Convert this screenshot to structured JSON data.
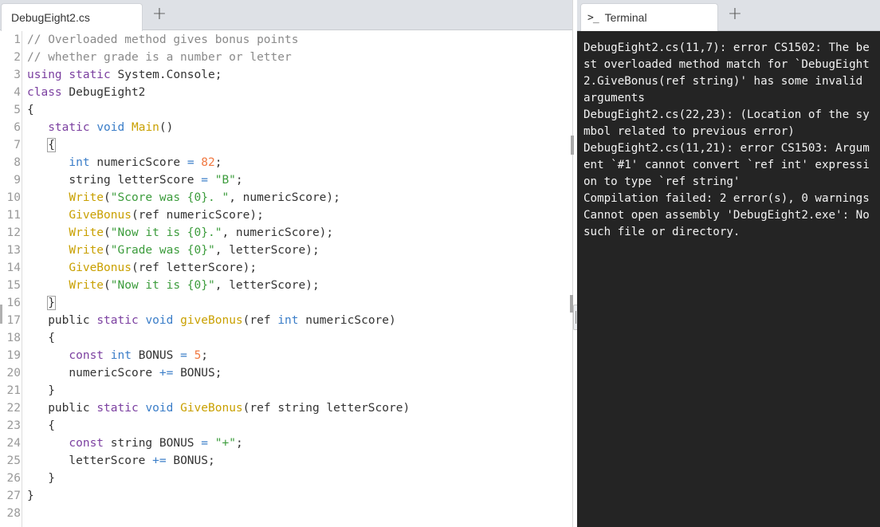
{
  "editor": {
    "tab_label": "DebugEight2.cs",
    "add_tab_label": "+",
    "lines": [
      [
        {
          "t": "// Overloaded method gives bonus points",
          "c": "comment"
        }
      ],
      [
        {
          "t": "// whether grade is a number or letter",
          "c": "comment"
        }
      ],
      [
        {
          "t": "using",
          "c": "kw"
        },
        {
          "t": " ",
          "c": "plain"
        },
        {
          "t": "static",
          "c": "kw"
        },
        {
          "t": " System.Console;",
          "c": "plain"
        }
      ],
      [
        {
          "t": "class",
          "c": "kw"
        },
        {
          "t": " DebugEight2",
          "c": "plain"
        }
      ],
      [
        {
          "t": "{",
          "c": "plain"
        }
      ],
      [
        {
          "t": "   ",
          "c": "plain"
        },
        {
          "t": "static",
          "c": "kw"
        },
        {
          "t": " ",
          "c": "plain"
        },
        {
          "t": "void",
          "c": "type"
        },
        {
          "t": " ",
          "c": "plain"
        },
        {
          "t": "Main",
          "c": "fn"
        },
        {
          "t": "()",
          "c": "plain"
        }
      ],
      [
        {
          "t": "   ",
          "c": "plain"
        },
        {
          "t": "{",
          "c": "plain",
          "m": true
        }
      ],
      [
        {
          "t": "      ",
          "c": "plain"
        },
        {
          "t": "int",
          "c": "type"
        },
        {
          "t": " numericScore ",
          "c": "plain"
        },
        {
          "t": "=",
          "c": "op"
        },
        {
          "t": " ",
          "c": "plain"
        },
        {
          "t": "82",
          "c": "num"
        },
        {
          "t": ";",
          "c": "plain"
        }
      ],
      [
        {
          "t": "      string letterScore ",
          "c": "plain"
        },
        {
          "t": "=",
          "c": "op"
        },
        {
          "t": " ",
          "c": "plain"
        },
        {
          "t": "\"B\"",
          "c": "str"
        },
        {
          "t": ";",
          "c": "plain"
        }
      ],
      [
        {
          "t": "      ",
          "c": "plain"
        },
        {
          "t": "Write",
          "c": "fn"
        },
        {
          "t": "(",
          "c": "plain"
        },
        {
          "t": "\"Score was {0}. \"",
          "c": "str"
        },
        {
          "t": ", numericScore);",
          "c": "plain"
        }
      ],
      [
        {
          "t": "      ",
          "c": "plain"
        },
        {
          "t": "GiveBonus",
          "c": "fn"
        },
        {
          "t": "(ref numericScore);",
          "c": "plain"
        }
      ],
      [
        {
          "t": "      ",
          "c": "plain"
        },
        {
          "t": "Write",
          "c": "fn"
        },
        {
          "t": "(",
          "c": "plain"
        },
        {
          "t": "\"Now it is {0}.\"",
          "c": "str"
        },
        {
          "t": ", numericScore);",
          "c": "plain"
        }
      ],
      [
        {
          "t": "      ",
          "c": "plain"
        },
        {
          "t": "Write",
          "c": "fn"
        },
        {
          "t": "(",
          "c": "plain"
        },
        {
          "t": "\"Grade was {0}\"",
          "c": "str"
        },
        {
          "t": ", letterScore);",
          "c": "plain"
        }
      ],
      [
        {
          "t": "      ",
          "c": "plain"
        },
        {
          "t": "GiveBonus",
          "c": "fn"
        },
        {
          "t": "(ref letterScore);",
          "c": "plain"
        }
      ],
      [
        {
          "t": "      ",
          "c": "plain"
        },
        {
          "t": "Write",
          "c": "fn"
        },
        {
          "t": "(",
          "c": "plain"
        },
        {
          "t": "\"Now it is {0}\"",
          "c": "str"
        },
        {
          "t": ", letterScore);",
          "c": "plain"
        }
      ],
      [
        {
          "t": "   ",
          "c": "plain"
        },
        {
          "t": "}",
          "c": "plain",
          "m": true
        }
      ],
      [
        {
          "t": "   public ",
          "c": "plain"
        },
        {
          "t": "static",
          "c": "kw"
        },
        {
          "t": " ",
          "c": "plain"
        },
        {
          "t": "void",
          "c": "type"
        },
        {
          "t": " ",
          "c": "plain"
        },
        {
          "t": "giveBonus",
          "c": "fn"
        },
        {
          "t": "(ref ",
          "c": "plain"
        },
        {
          "t": "int",
          "c": "type"
        },
        {
          "t": " numericScore)",
          "c": "plain"
        }
      ],
      [
        {
          "t": "   {",
          "c": "plain"
        }
      ],
      [
        {
          "t": "      ",
          "c": "plain"
        },
        {
          "t": "const",
          "c": "kw"
        },
        {
          "t": " ",
          "c": "plain"
        },
        {
          "t": "int",
          "c": "type"
        },
        {
          "t": " BONUS ",
          "c": "plain"
        },
        {
          "t": "=",
          "c": "op"
        },
        {
          "t": " ",
          "c": "plain"
        },
        {
          "t": "5",
          "c": "num"
        },
        {
          "t": ";",
          "c": "plain"
        }
      ],
      [
        {
          "t": "      numericScore ",
          "c": "plain"
        },
        {
          "t": "+=",
          "c": "op"
        },
        {
          "t": " BONUS;",
          "c": "plain"
        }
      ],
      [
        {
          "t": "   }",
          "c": "plain"
        }
      ],
      [
        {
          "t": "   public ",
          "c": "plain"
        },
        {
          "t": "static",
          "c": "kw"
        },
        {
          "t": " ",
          "c": "plain"
        },
        {
          "t": "void",
          "c": "type"
        },
        {
          "t": " ",
          "c": "plain"
        },
        {
          "t": "GiveBonus",
          "c": "fn"
        },
        {
          "t": "(ref string letterScore)",
          "c": "plain"
        }
      ],
      [
        {
          "t": "   {",
          "c": "plain"
        }
      ],
      [
        {
          "t": "      ",
          "c": "plain"
        },
        {
          "t": "const",
          "c": "kw"
        },
        {
          "t": " string BONUS ",
          "c": "plain"
        },
        {
          "t": "=",
          "c": "op"
        },
        {
          "t": " ",
          "c": "plain"
        },
        {
          "t": "\"+\"",
          "c": "str"
        },
        {
          "t": ";",
          "c": "plain"
        }
      ],
      [
        {
          "t": "      letterScore ",
          "c": "plain"
        },
        {
          "t": "+=",
          "c": "op"
        },
        {
          "t": " BONUS;",
          "c": "plain"
        }
      ],
      [
        {
          "t": "   }",
          "c": "plain"
        }
      ],
      [
        {
          "t": "}",
          "c": "plain"
        }
      ],
      []
    ]
  },
  "terminal": {
    "tab_label": "Terminal",
    "tab_icon": ">_",
    "add_tab_label": "+",
    "output": "DebugEight2.cs(11,7): error CS1502: The best overloaded method match for `DebugEight2.GiveBonus(ref string)' has some invalid arguments\nDebugEight2.cs(22,23): (Location of the symbol related to previous error)\nDebugEight2.cs(11,21): error CS1503: Argument `#1' cannot convert `ref int' expression to type `ref string'\nCompilation failed: 2 error(s), 0 warnings\nCannot open assembly 'DebugEight2.exe': No such file or directory."
  }
}
